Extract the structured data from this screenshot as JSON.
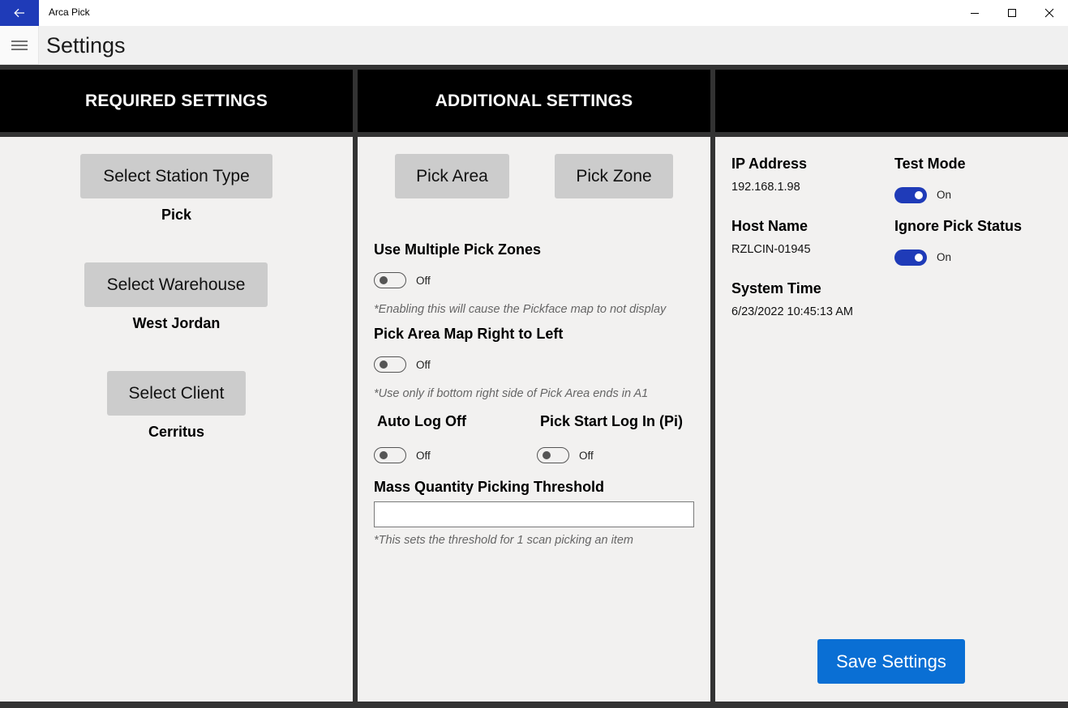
{
  "window": {
    "title": "Arca Pick",
    "icons": {
      "back": "back-arrow-icon",
      "minimize": "minimize-icon",
      "maximize": "maximize-icon",
      "close": "close-icon"
    }
  },
  "header": {
    "title": "Settings",
    "menu_icon": "hamburger-menu-icon"
  },
  "required": {
    "heading": "REQUIRED SETTINGS",
    "station_type": {
      "button": "Select Station Type",
      "value": "Pick"
    },
    "warehouse": {
      "button": "Select Warehouse",
      "value": "West Jordan"
    },
    "client": {
      "button": "Select Client",
      "value": "Cerritus"
    }
  },
  "additional": {
    "heading": "ADDITIONAL SETTINGS",
    "pick_area_button": "Pick Area",
    "pick_zone_button": "Pick Zone",
    "multiple_zones": {
      "label": "Use Multiple Pick Zones",
      "state": "Off",
      "checked": false,
      "note": "*Enabling this will cause the Pickface map to not display"
    },
    "map_rtl": {
      "label": "Pick Area Map Right to Left",
      "state": "Off",
      "checked": false,
      "note": "*Use only if bottom right side of Pick Area ends in A1"
    },
    "auto_log_off": {
      "label": "Auto Log Off",
      "state": "Off",
      "checked": false
    },
    "pick_start_login": {
      "label": "Pick Start Log In (Pi)",
      "state": "Off",
      "checked": false
    },
    "mass_qty": {
      "label": "Mass Quantity Picking Threshold",
      "value": "",
      "note": "*This sets the threshold for 1 scan picking an item"
    }
  },
  "info": {
    "heading": "",
    "ip_label": "IP Address",
    "ip_value": "192.168.1.98",
    "host_label": "Host Name",
    "host_value": "RZLCIN-01945",
    "time_label": "System Time",
    "time_value": "6/23/2022 10:45:13 AM",
    "test_mode": {
      "label": "Test Mode",
      "state": "On",
      "checked": true
    },
    "ignore_status": {
      "label": "Ignore Pick Status",
      "state": "On",
      "checked": true
    },
    "save_button": "Save Settings"
  },
  "colors": {
    "accent": "#1f3bb8",
    "save": "#0a6fd4",
    "header_bg": "#000000",
    "divider": "#333333"
  }
}
